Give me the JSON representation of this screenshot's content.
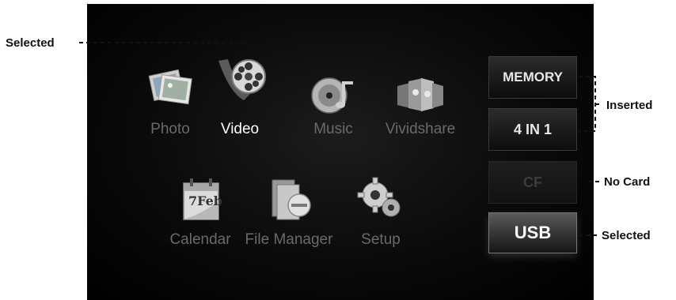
{
  "menu": {
    "items": [
      {
        "id": "photo",
        "label": "Photo",
        "icon": "photo-icon",
        "selected": false
      },
      {
        "id": "video",
        "label": "Video",
        "icon": "film-reel-icon",
        "selected": true
      },
      {
        "id": "music",
        "label": "Music",
        "icon": "music-disc-icon",
        "selected": false
      },
      {
        "id": "vividshare",
        "label": "Vividshare",
        "icon": "photo-slides-icon",
        "selected": false
      },
      {
        "id": "calendar",
        "label": "Calendar",
        "icon": "calendar-icon",
        "selected": false
      },
      {
        "id": "file-manager",
        "label": "File Manager",
        "icon": "file-manager-icon",
        "selected": false
      },
      {
        "id": "setup",
        "label": "Setup",
        "icon": "gear-icon",
        "selected": false
      }
    ],
    "calendar_icon_text": "7Feb"
  },
  "sources": [
    {
      "id": "memory",
      "label": "MEMORY",
      "state": "inserted"
    },
    {
      "id": "4in1",
      "label": "4 IN 1",
      "state": "inserted"
    },
    {
      "id": "cf",
      "label": "CF",
      "state": "no-card"
    },
    {
      "id": "usb",
      "label": "USB",
      "state": "selected"
    }
  ],
  "callouts": {
    "menu_selected": "Selected",
    "inserted": "Inserted",
    "no_card": "No Card",
    "usb_selected": "Selected"
  },
  "colors": {
    "screen_bg": "#000000",
    "label_dim": "#6a6a6a",
    "label_selected": "#ffffff",
    "callout_text": "#111111"
  }
}
